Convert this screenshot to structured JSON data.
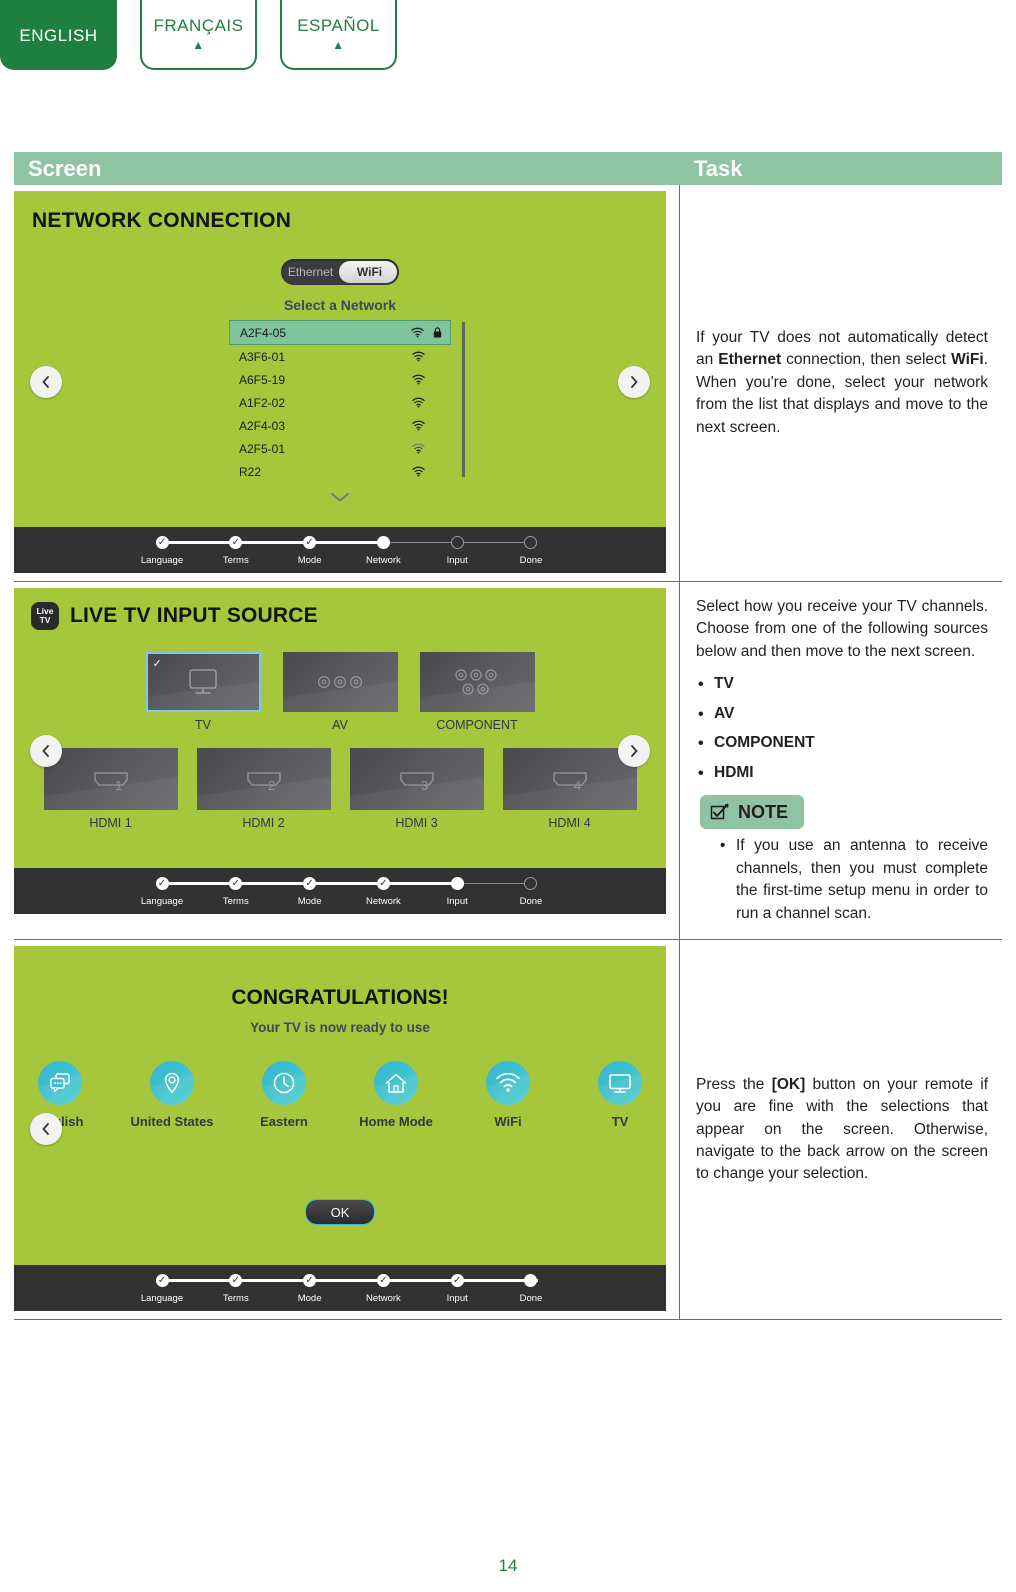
{
  "language_tabs": [
    {
      "label": "ENGLISH",
      "active": true,
      "marker": ""
    },
    {
      "label": "FRANÇAIS",
      "active": false,
      "marker": "▲"
    },
    {
      "label": "ESPAÑOL",
      "active": false,
      "marker": "▲"
    }
  ],
  "table": {
    "headers": {
      "screen": "Screen",
      "task": "Task"
    }
  },
  "colors": {
    "brand_green": "#1e7f3f",
    "header_sage": "#8fc3a1",
    "tv_green": "#a6c63c",
    "progress_bar": "#323232",
    "accent_cyan": "#39bfe8",
    "selected_row": "#80c49a"
  },
  "row1": {
    "screen": {
      "title": "NETWORK CONNECTION",
      "toggle": {
        "left_option": "Ethernet",
        "right_option": "WiFi",
        "selected": "WiFi"
      },
      "select_label": "Select a Network",
      "networks": [
        {
          "ssid": "A2F4-05",
          "selected": true,
          "locked": true
        },
        {
          "ssid": "A3F6-01",
          "selected": false,
          "locked": false
        },
        {
          "ssid": "A6F5-19",
          "selected": false,
          "locked": false
        },
        {
          "ssid": "A1F2-02",
          "selected": false,
          "locked": false
        },
        {
          "ssid": "A2F4-03",
          "selected": false,
          "locked": false
        },
        {
          "ssid": "A2F5-01",
          "selected": false,
          "locked": false
        },
        {
          "ssid": "R22",
          "selected": false,
          "locked": false
        }
      ],
      "scroll_more_icon": "chevron-down-icon",
      "progress": {
        "steps": [
          {
            "label": "Language",
            "state": "check"
          },
          {
            "label": "Terms",
            "state": "check"
          },
          {
            "label": "Mode",
            "state": "check"
          },
          {
            "label": "Network",
            "state": "current"
          },
          {
            "label": "Input",
            "state": "empty"
          },
          {
            "label": "Done",
            "state": "empty"
          }
        ],
        "completed_fraction": 0.6
      }
    },
    "task": {
      "text_parts": [
        {
          "t": "If your TV does not automatically detect an ",
          "b": false
        },
        {
          "t": "Ethernet",
          "b": true
        },
        {
          "t": " connection, then select ",
          "b": false
        },
        {
          "t": "WiFi",
          "b": true
        },
        {
          "t": ". When you're done, select your network from the list that displays and move to the next screen.",
          "b": false
        }
      ]
    }
  },
  "row2": {
    "screen": {
      "badge": {
        "line1": "Live",
        "line2": "TV"
      },
      "title": "LIVE TV INPUT SOURCE",
      "sources_row1": [
        {
          "label": "TV",
          "icon": "tv-icon",
          "selected": true
        },
        {
          "label": "AV",
          "icon": "av-rca-icon",
          "selected": false
        },
        {
          "label": "COMPONENT",
          "icon": "component-rca-icon",
          "selected": false
        }
      ],
      "sources_row2": [
        {
          "label": "HDMI 1",
          "icon": "hdmi-icon",
          "number": "1",
          "selected": false
        },
        {
          "label": "HDMI 2",
          "icon": "hdmi-icon",
          "number": "2",
          "selected": false
        },
        {
          "label": "HDMI 3",
          "icon": "hdmi-icon",
          "number": "3",
          "selected": false
        },
        {
          "label": "HDMI 4",
          "icon": "hdmi-icon",
          "number": "4",
          "selected": false
        }
      ],
      "progress": {
        "steps": [
          {
            "label": "Language",
            "state": "check"
          },
          {
            "label": "Terms",
            "state": "check"
          },
          {
            "label": "Mode",
            "state": "check"
          },
          {
            "label": "Network",
            "state": "check"
          },
          {
            "label": "Input",
            "state": "current"
          },
          {
            "label": "Done",
            "state": "empty"
          }
        ],
        "completed_fraction": 0.8
      }
    },
    "task": {
      "intro": "Select how you receive your TV channels. Choose from one of the following sources below and then move to the next screen.",
      "bullets": [
        "TV",
        "AV",
        "COMPONENT",
        "HDMI"
      ],
      "note_label": "NOTE",
      "note_icon": "note-checkbox-pencil-icon",
      "note_bullets": [
        "If you use an antenna to receive channels, then you must complete the first-time setup menu in order to run a channel scan."
      ]
    }
  },
  "row3": {
    "screen": {
      "title": "CONGRATULATIONS!",
      "subtitle": "Your TV is now ready to use",
      "summary": [
        {
          "label": "English",
          "icon": "language-bubbles-icon"
        },
        {
          "label": "United States",
          "icon": "location-pin-icon"
        },
        {
          "label": "Eastern",
          "icon": "clock-icon"
        },
        {
          "label": "Home Mode",
          "icon": "home-icon"
        },
        {
          "label": "WiFi",
          "icon": "wifi-icon"
        },
        {
          "label": "TV",
          "icon": "tv-icon"
        }
      ],
      "ok_button": "OK",
      "progress": {
        "steps": [
          {
            "label": "Language",
            "state": "check"
          },
          {
            "label": "Terms",
            "state": "check"
          },
          {
            "label": "Mode",
            "state": "check"
          },
          {
            "label": "Network",
            "state": "check"
          },
          {
            "label": "Input",
            "state": "check"
          },
          {
            "label": "Done",
            "state": "current"
          }
        ],
        "completed_fraction": 1.0
      }
    },
    "task": {
      "text_parts": [
        {
          "t": "Press the ",
          "b": false
        },
        {
          "t": "[OK]",
          "b": true
        },
        {
          "t": " button on your remote if you are fine with the selections that appear on the screen. Otherwise, navigate to the back arrow on the screen to change your selection.",
          "b": false
        }
      ]
    }
  },
  "footer": {
    "page_number": "14"
  }
}
